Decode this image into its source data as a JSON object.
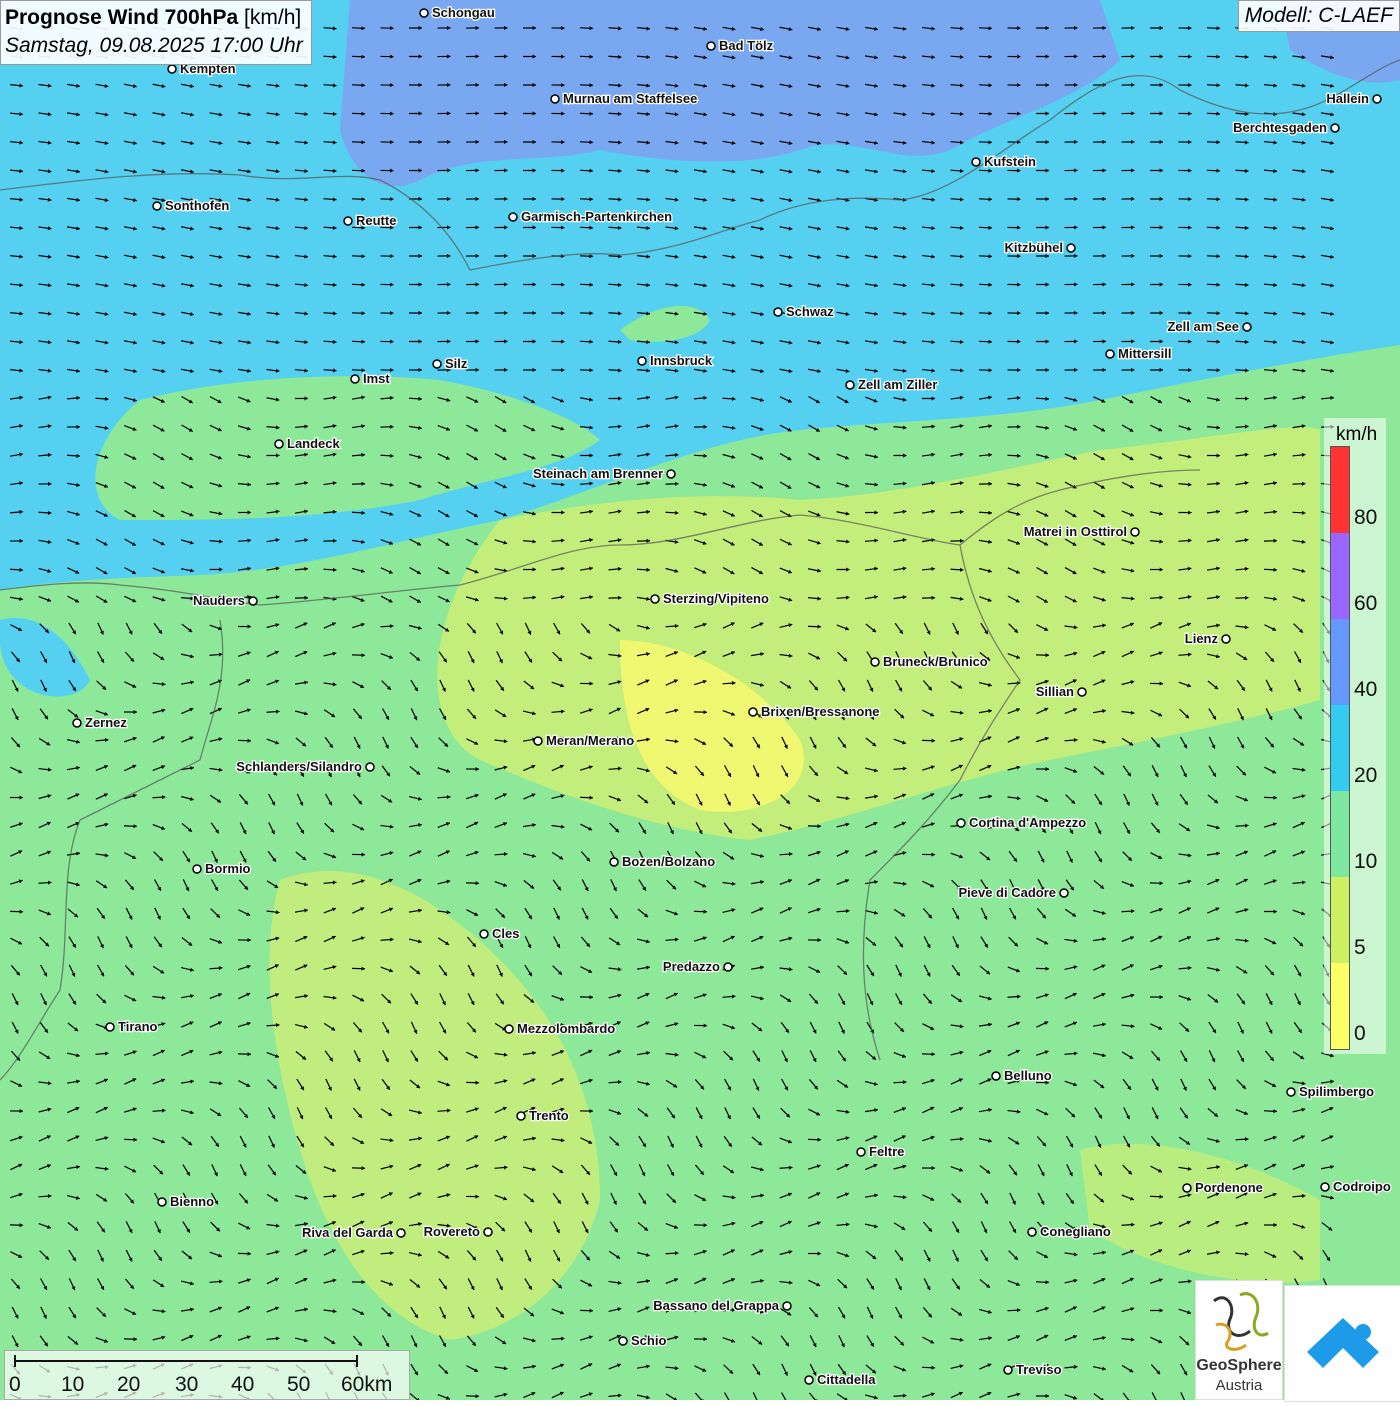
{
  "title": {
    "bold": "Prognose Wind 700hPa",
    "unit": " [km/h]",
    "datetime": "Samstag, 09.08.2025 17:00 Uhr"
  },
  "model": "Modell: C-LAEF",
  "legend": {
    "unit": "km/h",
    "labels": [
      "80",
      "60",
      "40",
      "20",
      "10",
      "5",
      "0"
    ],
    "colors": [
      "#ff3333",
      "#9966ff",
      "#6699ff",
      "#33ccf0",
      "#7fe8a0",
      "#ccf060",
      "#ffff66"
    ]
  },
  "scale": {
    "labels": [
      "0",
      "10",
      "20",
      "30",
      "40",
      "50",
      "60km"
    ]
  },
  "logos": {
    "geosphere_name": "GeoSphere",
    "geosphere_sub": "Austria"
  },
  "cities": [
    {
      "name": "Schongau"
    },
    {
      "name": "Bad Tölz"
    },
    {
      "name": "Kempten"
    },
    {
      "name": "Murnau am Staffelsee"
    },
    {
      "name": "Hallein"
    },
    {
      "name": "Berchtesgaden"
    },
    {
      "name": "Kufstein"
    },
    {
      "name": "Sonthofen"
    },
    {
      "name": "Reutte"
    },
    {
      "name": "Garmisch-Partenkirchen"
    },
    {
      "name": "Kitzbühel"
    },
    {
      "name": "Schwaz"
    },
    {
      "name": "Zell am See"
    },
    {
      "name": "Innsbruck"
    },
    {
      "name": "Mittersill"
    },
    {
      "name": "Silz"
    },
    {
      "name": "Imst"
    },
    {
      "name": "Zell am Ziller"
    },
    {
      "name": "Landeck"
    },
    {
      "name": "Steinach am Brenner"
    },
    {
      "name": "Matrei in Osttirol"
    },
    {
      "name": "Nauders"
    },
    {
      "name": "Sterzing/Vipiteno"
    },
    {
      "name": "Lienz"
    },
    {
      "name": "Bruneck/Brunico"
    },
    {
      "name": "Sillian"
    },
    {
      "name": "Brixen/Bressanone"
    },
    {
      "name": "Zernez"
    },
    {
      "name": "Meran/Merano"
    },
    {
      "name": "Schlanders/Silandro"
    },
    {
      "name": "Cortina d'Ampezzo"
    },
    {
      "name": "Bozen/Bolzano"
    },
    {
      "name": "Bormio"
    },
    {
      "name": "Pieve di Cadore"
    },
    {
      "name": "Cles"
    },
    {
      "name": "Predazzo"
    },
    {
      "name": "Tirano"
    },
    {
      "name": "Mezzolombardo"
    },
    {
      "name": "Belluno"
    },
    {
      "name": "Spilimbergo"
    },
    {
      "name": "Trento"
    },
    {
      "name": "Feltre"
    },
    {
      "name": "Pordenone"
    },
    {
      "name": "Codroipo"
    },
    {
      "name": "Bienno"
    },
    {
      "name": "Riva del Garda"
    },
    {
      "name": "Rovereto"
    },
    {
      "name": "Conegliano"
    },
    {
      "name": "Bassano del Grappa"
    },
    {
      "name": "Schio"
    },
    {
      "name": "Treviso"
    },
    {
      "name": "Cittadella"
    }
  ]
}
